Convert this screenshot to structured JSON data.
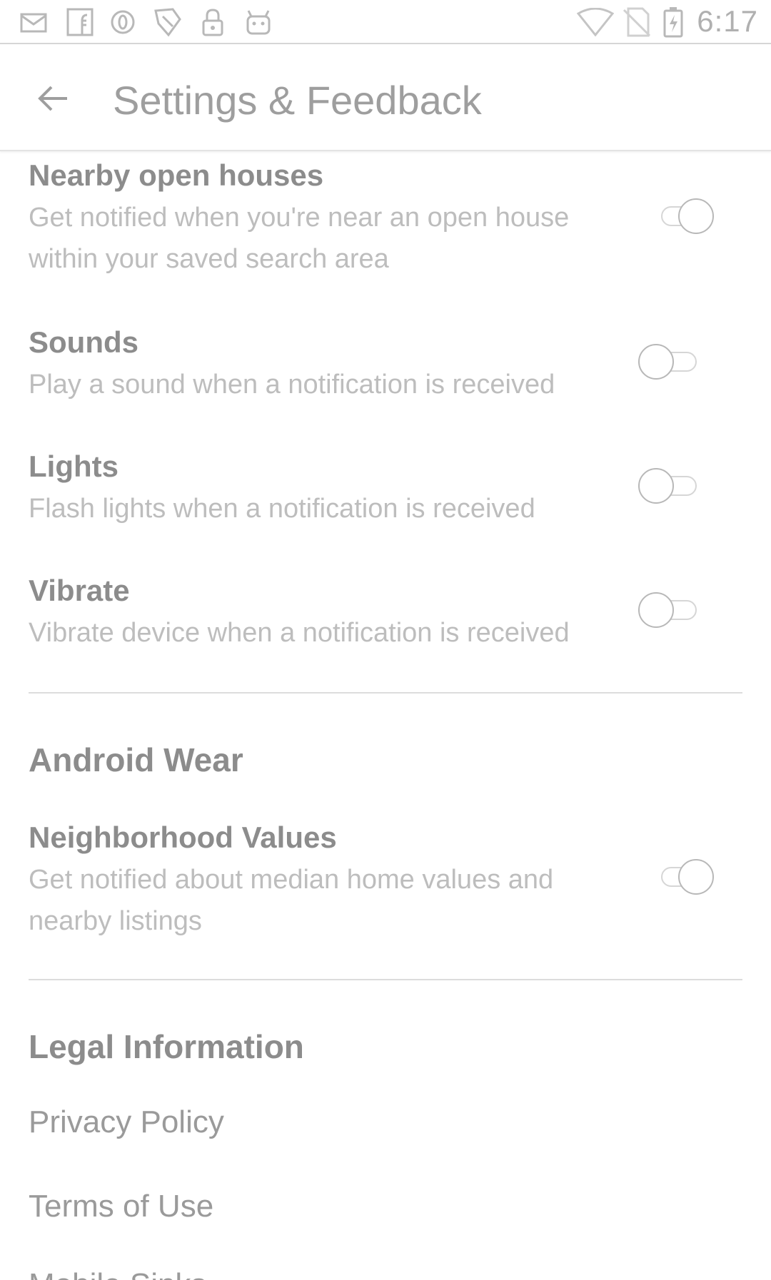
{
  "status_bar": {
    "time": "6:17",
    "left_icons": [
      "mail-icon",
      "facebook-icon",
      "opera-icon",
      "kite-icon",
      "lock-icon",
      "android-icon"
    ],
    "right_icons": [
      "wifi-icon",
      "no-sim-icon",
      "battery-charging-icon"
    ]
  },
  "app_bar": {
    "title": "Settings & Feedback"
  },
  "settings": [
    {
      "title": "Nearby open houses",
      "desc": "Get notified when you're near an open house within your saved search area",
      "on": true
    },
    {
      "title": "Sounds",
      "desc": "Play a sound when a notification is received",
      "on": false
    },
    {
      "title": "Lights",
      "desc": "Flash lights when a notification is received",
      "on": false
    },
    {
      "title": "Vibrate",
      "desc": "Vibrate device when a notification is received",
      "on": false
    }
  ],
  "android_wear": {
    "header": "Android Wear",
    "item": {
      "title": "Neighborhood Values",
      "desc": "Get notified about median home values and nearby listings",
      "on": true
    }
  },
  "legal": {
    "header": "Legal Information",
    "links": [
      "Privacy Policy",
      "Terms of Use",
      "Mobile Sinks"
    ]
  },
  "colors": {
    "text_primary": "#8c8c8c",
    "text_secondary": "#bdbdbd",
    "divider": "#dcdcdc",
    "background": "#ffffff"
  }
}
